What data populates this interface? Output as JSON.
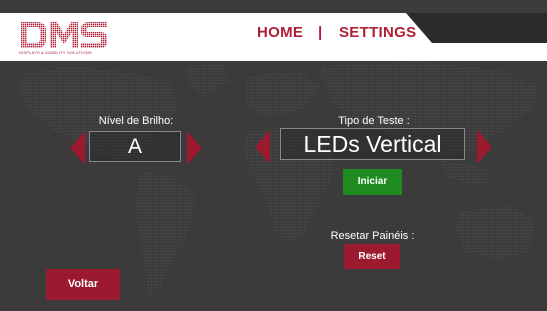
{
  "header": {
    "logo_text": "DMS",
    "logo_subtitle": "DISPLAYS & MOBILITY SOLUTIONS",
    "nav_home": "HOME",
    "nav_separator": "|",
    "nav_settings": "SETTINGS"
  },
  "brightness": {
    "label": "Nível de Brilho:",
    "value": "A"
  },
  "test_type": {
    "label": "Tipo de Teste :",
    "value": "LEDs Vertical",
    "start_button": "Iniciar"
  },
  "reset_panels": {
    "label": "Resetar Painéis :",
    "button": "Reset"
  },
  "back_button": "Voltar",
  "colors": {
    "accent": "#9c1a2f",
    "start_green": "#1f8a1f",
    "background": "#3b3b3b"
  }
}
